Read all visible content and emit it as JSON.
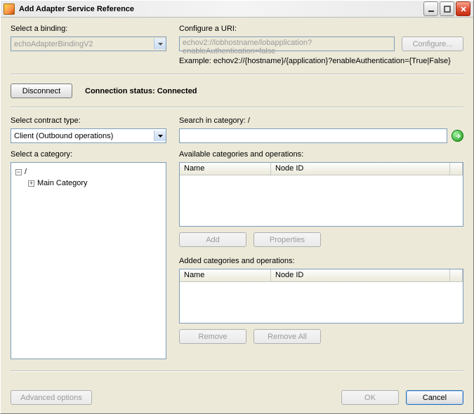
{
  "window": {
    "title": "Add Adapter Service Reference"
  },
  "top": {
    "binding_label": "Select a binding:",
    "binding_value": "echoAdapterBindingV2",
    "uri_label": "Configure a URI:",
    "uri_value": "echov2://lobhostname/lobapplication?enableAuthentication=false",
    "example": "Example: echov2://{hostname}/{application}?enableAuthentication={True|False}",
    "configure_btn": "Configure..."
  },
  "status": {
    "disconnect_btn": "Disconnect",
    "label": "Connection status:",
    "value": "Connected"
  },
  "contract": {
    "label": "Select contract type:",
    "value": "Client (Outbound operations)"
  },
  "search": {
    "label": "Search in category: /",
    "value": ""
  },
  "category": {
    "label": "Select a category:",
    "root": "/",
    "child": "Main Category"
  },
  "available": {
    "label": "Available categories and operations:",
    "col_name": "Name",
    "col_node": "Node ID",
    "add_btn": "Add",
    "props_btn": "Properties"
  },
  "added": {
    "label": "Added categories and operations:",
    "col_name": "Name",
    "col_node": "Node ID",
    "remove_btn": "Remove",
    "removeall_btn": "Remove All"
  },
  "footer": {
    "advanced_btn": "Advanced options",
    "ok_btn": "OK",
    "cancel_btn": "Cancel"
  }
}
